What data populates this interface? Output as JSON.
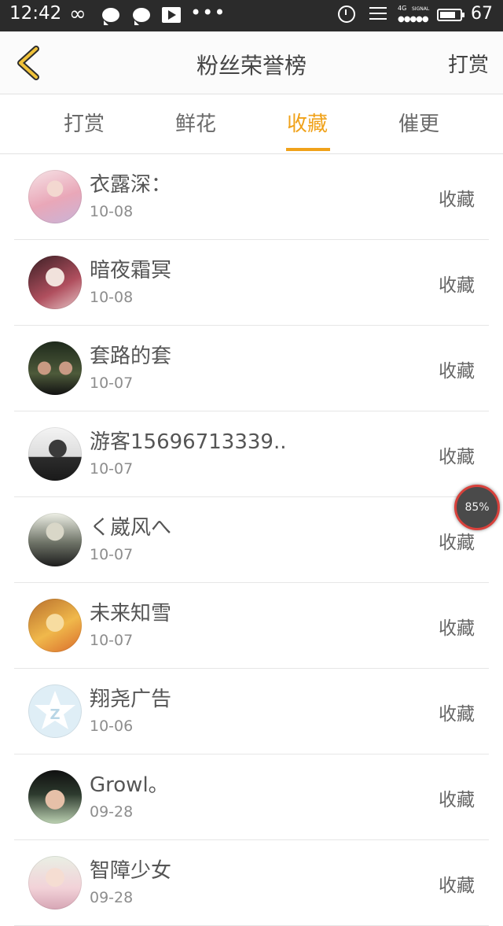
{
  "status_bar": {
    "time": "12:42",
    "infinity_glyph": "∞",
    "dots_glyph": "•••",
    "network_label": "4G",
    "signal_label": "SIGNAL",
    "signal_dots": "●●●●●",
    "battery_percent": "67",
    "icons": [
      "infinity-icon",
      "chat-bubble-icon",
      "chat-bubble-icon",
      "video-play-icon",
      "more-dots-icon",
      "alarm-icon",
      "menu-lines-icon",
      "signal-icon",
      "battery-icon"
    ]
  },
  "navbar": {
    "title": "粉丝荣誉榜",
    "action": "打赏",
    "back_icon": "chevron-left-icon",
    "accent": "#f0a21a"
  },
  "tabs": [
    {
      "label": "打赏",
      "active": false
    },
    {
      "label": "鲜花",
      "active": false
    },
    {
      "label": "收藏",
      "active": true
    },
    {
      "label": "催更",
      "active": false
    }
  ],
  "rows": [
    {
      "name": "衣露深：",
      "date": "10-08",
      "action": "收藏"
    },
    {
      "name": "暗夜霜冥",
      "date": "10-08",
      "action": "收藏"
    },
    {
      "name": "套路的套",
      "date": "10-07",
      "action": "收藏"
    },
    {
      "name": "游客15696713339..",
      "date": "10-07",
      "action": "收藏"
    },
    {
      "name": "く崴风へ",
      "date": "10-07",
      "action": "收藏"
    },
    {
      "name": "未来知雪",
      "date": "10-07",
      "action": "收藏"
    },
    {
      "name": "翔尧广告",
      "date": "10-06",
      "action": "收藏"
    },
    {
      "name": "Growl。",
      "date": "09-28",
      "action": "收藏"
    },
    {
      "name": "智障少女",
      "date": "09-28",
      "action": "收藏"
    }
  ],
  "floating_widget": {
    "progress": "85%",
    "progress_fraction": 0.85,
    "ring_color": "#d8413b"
  }
}
